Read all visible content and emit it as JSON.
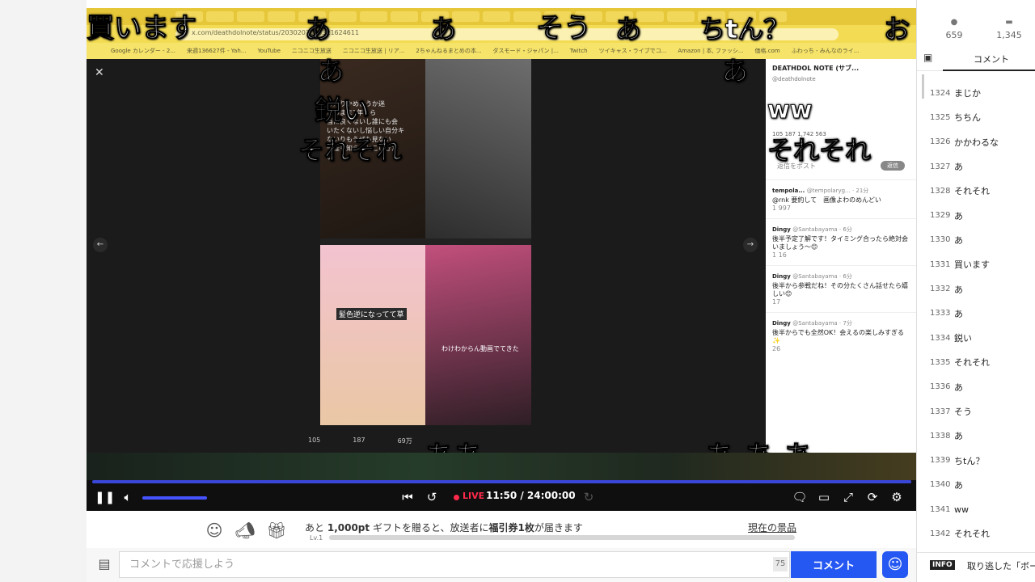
{
  "stream": {
    "captured_url": "x.com/deathdolnote/status/2030207063321624611",
    "bookmarks": [
      "Google カレンダー - 2...",
      "来週136627件 - Yah...",
      "YouTube",
      "ニコニコ生放送",
      "ニコニコ生放送 | リア...",
      "2ちゃんねるまとめの本...",
      "ダスモード・ジャパン |...",
      "Twitch",
      "ツイキャス・ライブでコ...",
      "Amazon | 本, ファッシ...",
      "価格.com",
      "ふわっち - みんなのライ..."
    ],
    "image_caption_a": "ら入りやめようか迷\nこのまま1年くら\n当に良くないし誰にも会\nいたくないし悩しい自分キ\nないりもうぜも見ない\n一誰も知らんとこいきた\nい",
    "image_caption_b": "髪色逆になってて草",
    "image_caption_c": "わけわからん動画でてきた",
    "image_stats": [
      "105",
      "187",
      "69万"
    ],
    "tweet": {
      "account": "DEATHDOL NOTE (サブ...",
      "handle": "@deathdolnote",
      "stats": "105    187    1,742    563",
      "reply_placeholder": "返信をポスト",
      "reply_button": "返信"
    },
    "replies": [
      {
        "name": "tempola...",
        "meta": "@tempolaryg... · 21分",
        "text": "@rnk 要約して　画像よわのめんどい",
        "stats": "1    997"
      },
      {
        "name": "Dingy",
        "meta": "@Santabayama · 6分",
        "text": "後半予定了解です！タイミング合ったら絶対会いましょう～😊",
        "stats": "1    16"
      },
      {
        "name": "Dingy",
        "meta": "@Santabayama · 6分",
        "text": "後半から参戦だね！その分たくさん話せたら嬉しい😊",
        "stats": "17"
      },
      {
        "name": "Dingy",
        "meta": "@Santabayama · 7分",
        "text": "後半からでも全然OK！会えるの楽しみすぎる✨",
        "stats": "26"
      }
    ]
  },
  "danmaku": [
    {
      "text": "買います",
      "size": 34
    },
    {
      "text": "あ",
      "size": 32
    },
    {
      "text": "あ",
      "size": 32
    },
    {
      "text": "そう",
      "size": 34
    },
    {
      "text": "あ",
      "size": 32
    },
    {
      "text": "ちtん？",
      "size": 32
    },
    {
      "text": "お",
      "size": 32
    },
    {
      "text": "あ",
      "size": 32
    },
    {
      "text": "あ",
      "size": 32
    },
    {
      "text": "ww",
      "size": 30
    },
    {
      "text": "鋭い",
      "size": 34
    },
    {
      "text": "それそれ",
      "size": 32
    },
    {
      "text": "それそれ",
      "size": 32
    },
    {
      "text": "ああ",
      "size": 36
    },
    {
      "text": "あ あ あ",
      "size": 36
    }
  ],
  "player": {
    "live_label": "LIVE",
    "time": "11:50 / 24:00:00",
    "seek_progress": 1.0,
    "volume_level": 1.0
  },
  "gift": {
    "text_prefix": "あと",
    "amount": "1,000pt",
    "text_mid": "ギフトを贈ると、放送者に",
    "reward": "福引券1枚",
    "text_suffix": "が届きます",
    "prize_link": "現在の景品",
    "level": "Lv.1",
    "progress": 0.0
  },
  "comment_input": {
    "placeholder": "コメントで応援しよう",
    "char_limit": "75",
    "send_label": "コメント"
  },
  "sidebar": {
    "viewers": "659",
    "comments_count": "1,345",
    "tab_label": "コメント",
    "comments": [
      {
        "no": "1324",
        "text": "まじか"
      },
      {
        "no": "1325",
        "text": "ちちん"
      },
      {
        "no": "1326",
        "text": "かかわるな"
      },
      {
        "no": "1327",
        "text": "あ"
      },
      {
        "no": "1328",
        "text": "それそれ"
      },
      {
        "no": "1329",
        "text": "あ"
      },
      {
        "no": "1330",
        "text": "あ"
      },
      {
        "no": "1331",
        "text": "買います"
      },
      {
        "no": "1332",
        "text": "あ"
      },
      {
        "no": "1333",
        "text": "あ"
      },
      {
        "no": "1334",
        "text": "鋭い"
      },
      {
        "no": "1335",
        "text": "それそれ"
      },
      {
        "no": "1336",
        "text": "あ"
      },
      {
        "no": "1337",
        "text": "そう"
      },
      {
        "no": "1338",
        "text": "あ"
      },
      {
        "no": "1339",
        "text": "ちtん？"
      },
      {
        "no": "1340",
        "text": "あ"
      },
      {
        "no": "1341",
        "text": "ww"
      },
      {
        "no": "1342",
        "text": "それそれ"
      }
    ],
    "info_badge": "INFO",
    "info_text": "取り逃した「ボー"
  }
}
